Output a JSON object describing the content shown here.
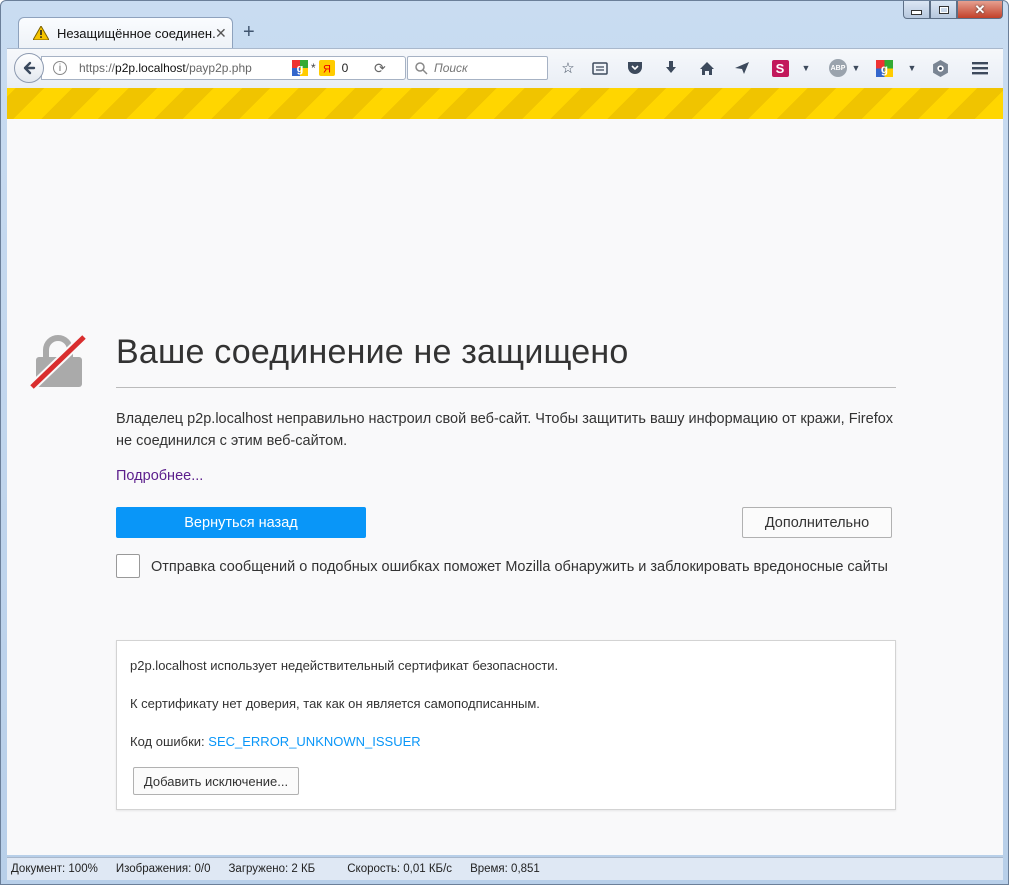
{
  "tab": {
    "title": "Незащищённое соединен..."
  },
  "address": {
    "scheme": "https://",
    "host": "p2p.localhost",
    "path": "/payp2p.php",
    "counter": "0"
  },
  "search": {
    "placeholder": "Поиск"
  },
  "toolbar": {
    "abp_label": "ABP"
  },
  "error": {
    "heading": "Ваше соединение не защищено",
    "description": "Владелец p2p.localhost неправильно настроил свой веб-сайт. Чтобы защитить вашу информацию от кражи, Firefox не соединился с этим веб-сайтом.",
    "learn_more": "Подробнее...",
    "go_back": "Вернуться назад",
    "advanced": "Дополнительно",
    "report_label": "Отправка сообщений о подобных ошибках поможет Mozilla обнаружить и заблокировать вредоносные сайты"
  },
  "advanced_panel": {
    "line1": "p2p.localhost использует недействительный сертификат безопасности.",
    "line2": "К сертификату нет доверия, так как он является самоподписанным.",
    "code_label": "Код ошибки:",
    "code": "SEC_ERROR_UNKNOWN_ISSUER",
    "add_exception": "Добавить исключение..."
  },
  "status": {
    "document": "Документ: 100%",
    "images": "Изображения: 0/0",
    "loaded": "Загружено: 2 КБ",
    "speed": "Скорость: 0,01 КБ/с",
    "time": "Время: 0,851"
  },
  "colors": {
    "accent": "#0996f8",
    "warning_stripe": "#ffd600",
    "link_visited": "#5b1e8c"
  }
}
